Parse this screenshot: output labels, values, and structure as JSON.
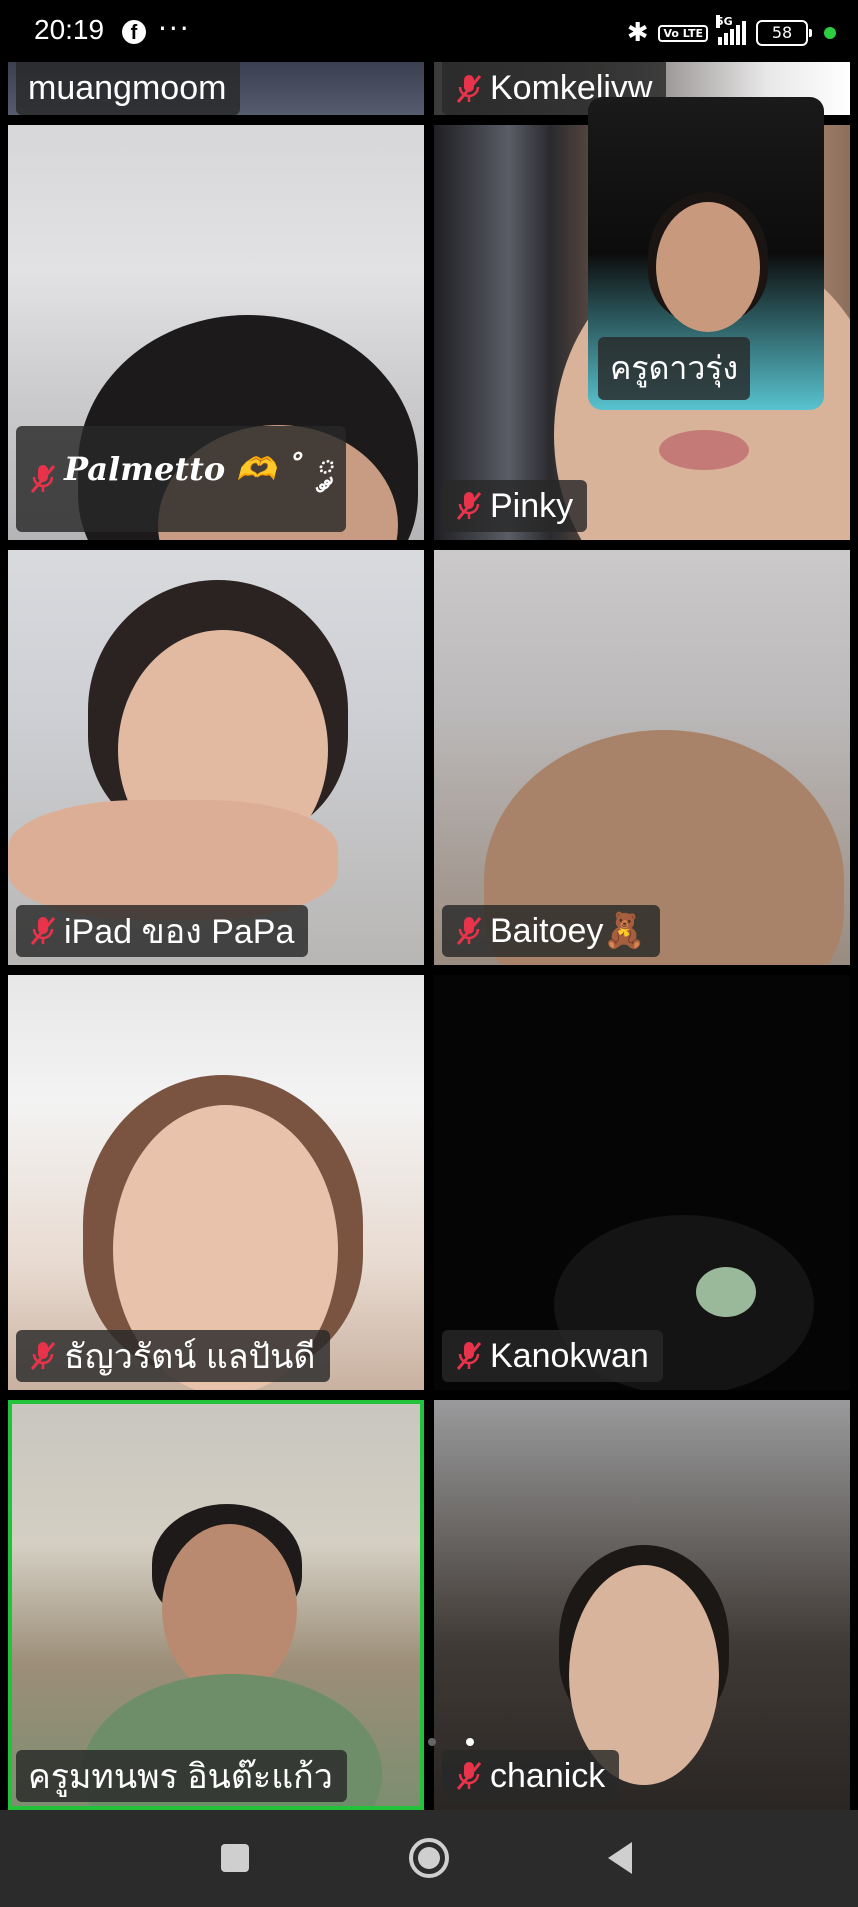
{
  "status_bar": {
    "time": "20:19",
    "app_badge": "f",
    "more": "···",
    "volte": "Vo LTE",
    "network": "5G",
    "battery": "58"
  },
  "participants": [
    {
      "name": "muangmoom",
      "muted": false
    },
    {
      "name": "Komkelivw",
      "muted": true
    },
    {
      "name": "Palmetto 🫶 ˚ ༘",
      "muted": true
    },
    {
      "name": "Pinky",
      "muted": true
    },
    {
      "name": "iPad ของ PaPa",
      "muted": true
    },
    {
      "name": "Baitoey🧸",
      "muted": true
    },
    {
      "name": "ธัญวรัตน์ แลปันดี",
      "muted": true
    },
    {
      "name": "Kanokwan",
      "muted": true
    },
    {
      "name": "ครูมทนพร อินต๊ะแก้ว",
      "muted": false,
      "active_speaker": true
    },
    {
      "name": "chanick",
      "muted": true
    }
  ],
  "self_view": {
    "name": "ครูดาวรุ่ง"
  },
  "colors": {
    "active_speaker_border": "#22c23a",
    "mic_muted": "#e8334a",
    "label_bg": "#282828"
  },
  "icons": {
    "nav_recent": "square-icon",
    "nav_home": "circle-icon",
    "nav_back": "triangle-back-icon"
  }
}
